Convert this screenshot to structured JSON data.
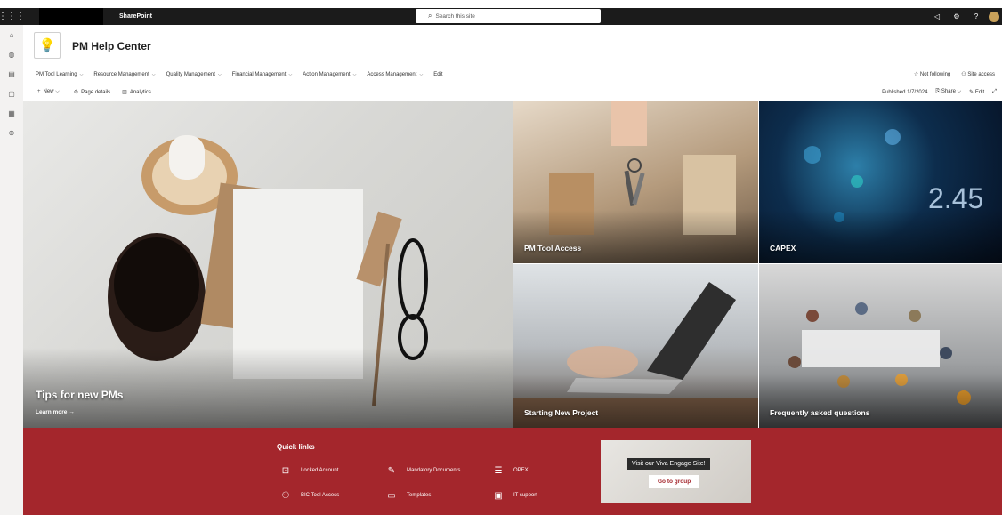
{
  "suitebar": {
    "app_name": "SharePoint",
    "search_placeholder": "Search this site"
  },
  "site": {
    "title": "PM Help Center"
  },
  "nav": {
    "items": [
      {
        "label": "PM Tool Learning"
      },
      {
        "label": "Resource Management"
      },
      {
        "label": "Quality Management"
      },
      {
        "label": "Financial Management"
      },
      {
        "label": "Action Management"
      },
      {
        "label": "Access Management"
      },
      {
        "label": "Edit"
      }
    ],
    "not_following": "Not following",
    "site_access": "Site access"
  },
  "commandbar": {
    "new": "New",
    "page_details": "Page details",
    "analytics": "Analytics",
    "published": "Published 1/7/2024",
    "share": "Share",
    "edit": "Edit"
  },
  "hero": {
    "main": {
      "title": "Tips for new PMs",
      "link": "Learn more →"
    },
    "tiles": [
      {
        "title": "PM Tool Access"
      },
      {
        "title": "CAPEX"
      },
      {
        "title": "Starting New Project"
      },
      {
        "title": "Frequently asked questions"
      }
    ]
  },
  "quick_links": {
    "title": "Quick links",
    "items": [
      {
        "label": "Locked Account",
        "icon": "lock-icon"
      },
      {
        "label": "Mandatory Documents",
        "icon": "document-edit-icon"
      },
      {
        "label": "OPEX",
        "icon": "list-icon"
      },
      {
        "label": "BIC Tool Access",
        "icon": "people-icon"
      },
      {
        "label": "Templates",
        "icon": "document-icon"
      },
      {
        "label": "IT support",
        "icon": "support-icon"
      }
    ]
  },
  "viva": {
    "title": "Visit our Viva Engage Site!",
    "button": "Go to group"
  },
  "colors": {
    "suitebar": "#1b1b1b",
    "band": "#a4262c"
  }
}
